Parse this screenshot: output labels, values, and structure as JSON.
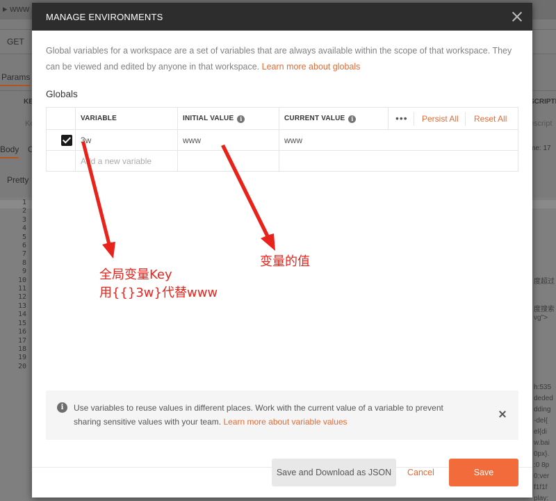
{
  "background_app": {
    "tab_label": "www",
    "method": "GET",
    "params_tab": "Params",
    "key_col": "KE",
    "key_placeholder": "Ke",
    "description_col": "SCRIPTI",
    "description_placeholder": "escript",
    "body_tab": "Body",
    "body_tab2": "C",
    "pretty_tab": "Pretty",
    "time_label": "me: 17",
    "line_numbers": [
      "1",
      "2",
      "3",
      "4",
      "5",
      "6",
      "7",
      "8",
      "9",
      "10",
      "11",
      "12",
      "13",
      "14",
      "15",
      "16",
      "17",
      "18",
      "19",
      "20"
    ],
    "right_snippets": [
      "度超过",
      "度搜索",
      "vg\">",
      "h:535",
      "deded",
      "dding",
      "-del{",
      "el{di",
      "w.bai",
      "0px}.",
      ":0 8p",
      "0;ver",
      "f1f1f",
      "play:"
    ]
  },
  "modal": {
    "title": "MANAGE ENVIRONMENTS",
    "description": "Global variables for a workspace are a set of variables that are always available within the scope of that workspace. They can be viewed and edited by anyone in that workspace.",
    "learn_more_globals": "Learn more about globals",
    "section_title": "Globals",
    "table": {
      "headers": {
        "variable": "VARIABLE",
        "initial_value": "INITIAL VALUE",
        "current_value": "CURRENT VALUE",
        "more": "•••",
        "persist_all": "Persist All",
        "reset_all": "Reset All"
      },
      "rows": [
        {
          "checked": true,
          "variable": "3w",
          "initial_value": "www",
          "current_value": "www"
        }
      ],
      "new_row_placeholder": "Add a new variable"
    },
    "banner": {
      "text": "Use variables to reuse values in different places. Work with the current value of a variable to prevent sharing sensitive values with your team.",
      "link": "Learn more about variable values"
    },
    "footer": {
      "save_download": "Save and Download as JSON",
      "cancel": "Cancel",
      "save": "Save"
    }
  },
  "annotations": {
    "left_line1": "全局变量Key",
    "left_line2": "用{{}3w}代替www",
    "right_label": "变量的值",
    "color": "#e8231b"
  },
  "colors": {
    "accent": "#e46a34",
    "save_button": "#f26b3a",
    "header_bg": "#2d2d2d"
  }
}
